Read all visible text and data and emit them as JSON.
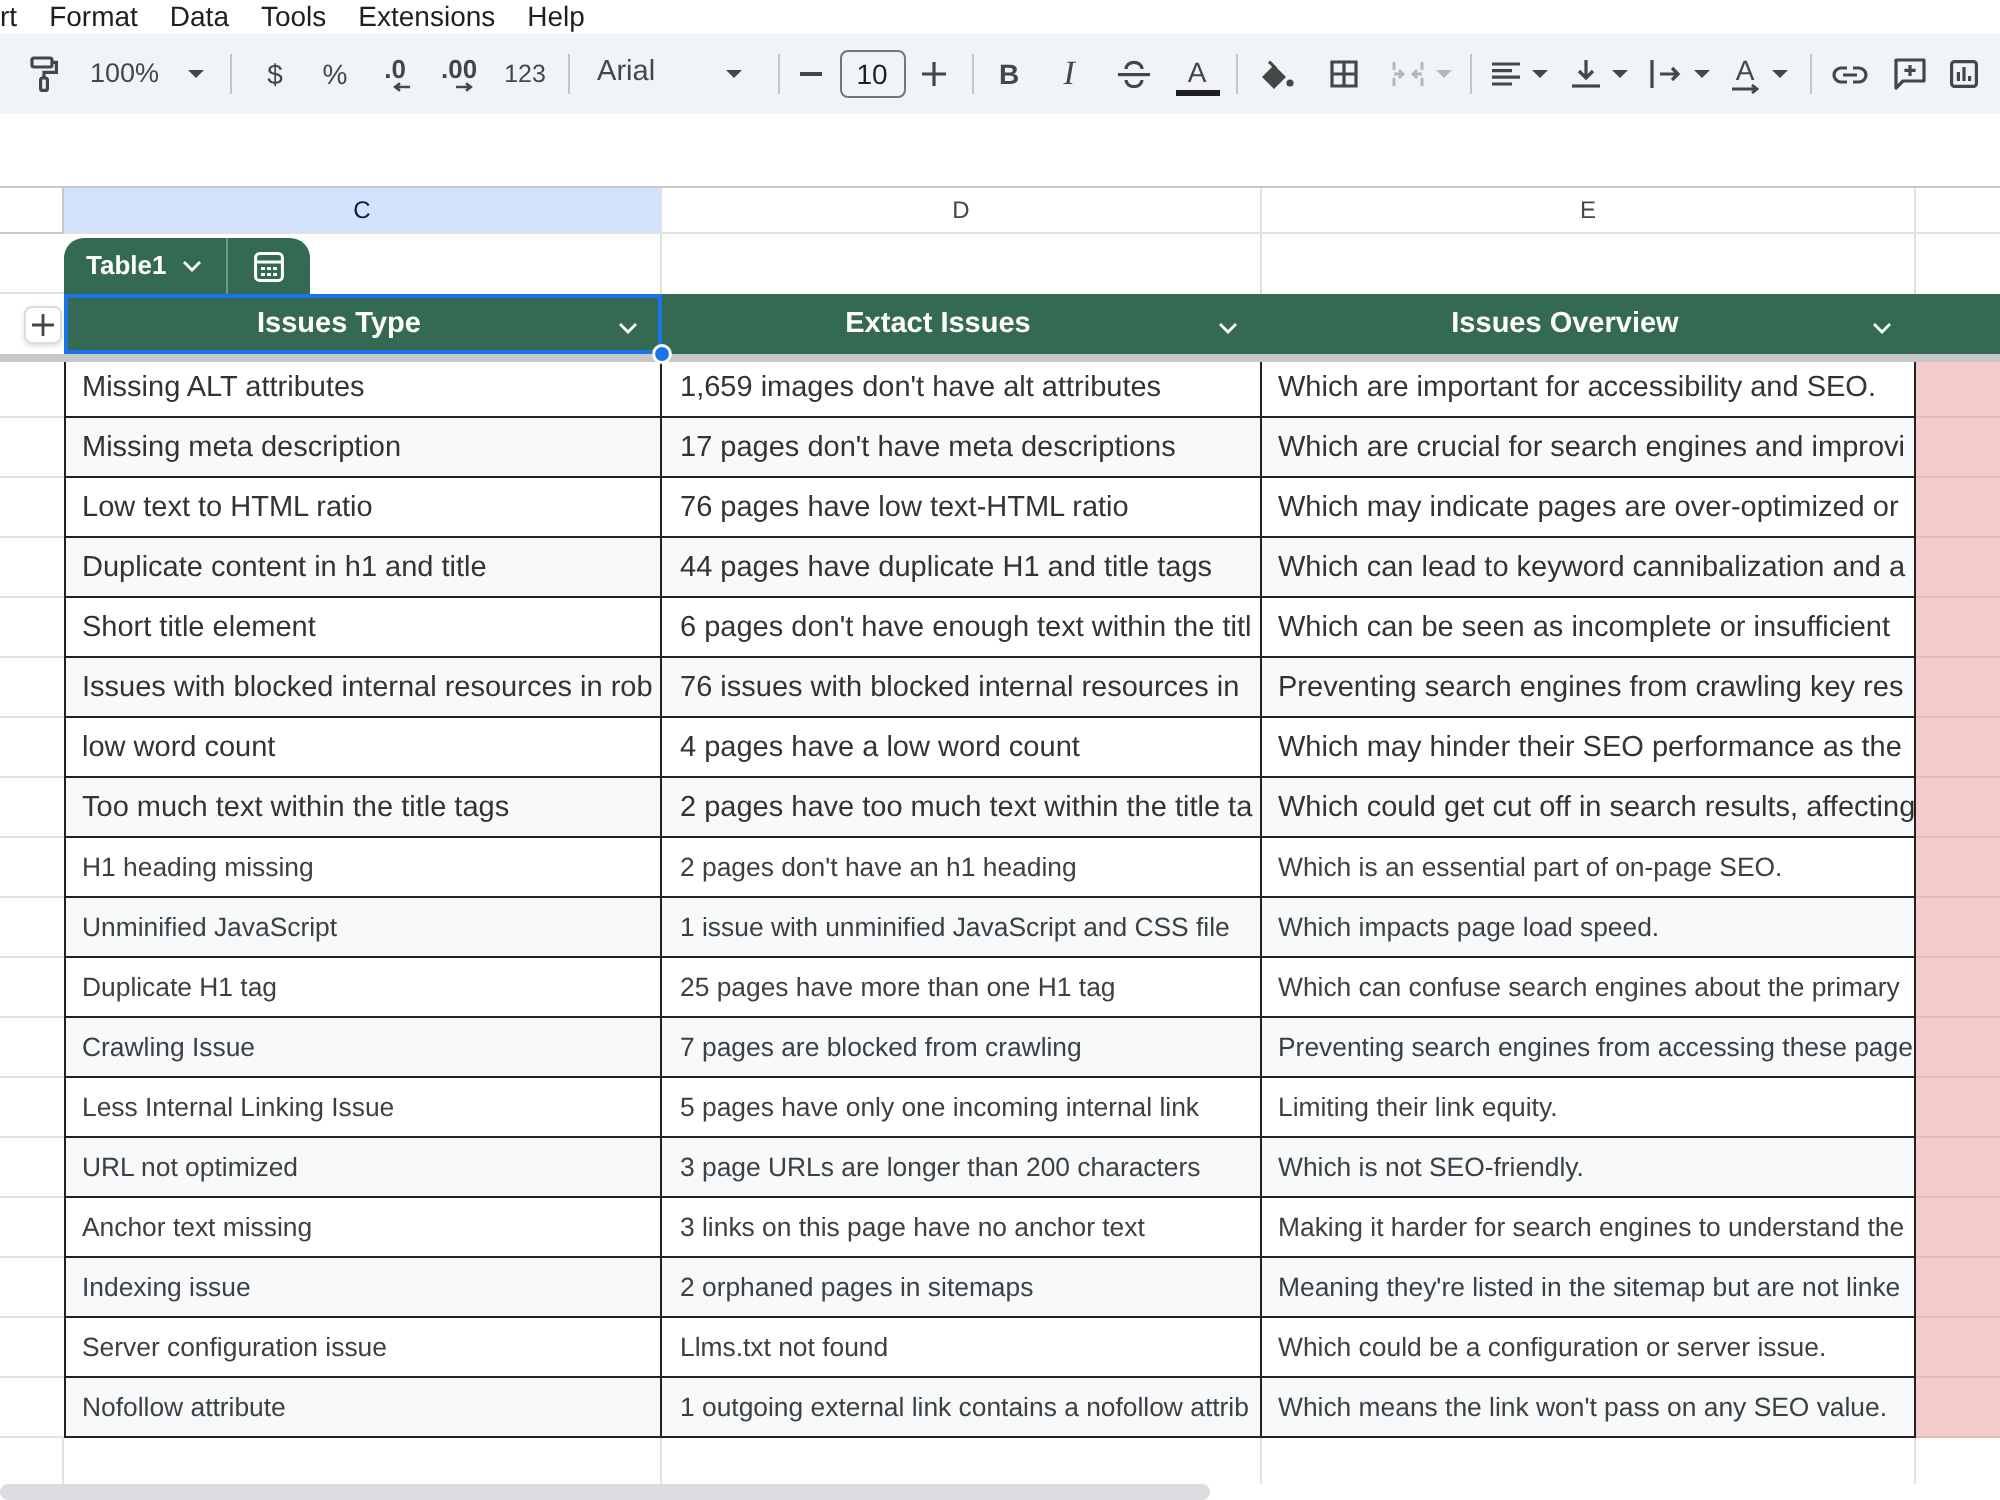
{
  "menu_bar": {
    "items": [
      "rt",
      "Format",
      "Data",
      "Tools",
      "Extensions",
      "Help"
    ]
  },
  "toolbar": {
    "zoom": "100%",
    "currency": "$",
    "percent": "%",
    "decimal_buttons": [
      {
        "label": ".0",
        "kind": "decrease"
      },
      {
        "label": ".00",
        "kind": "increase"
      }
    ],
    "number_format": "123",
    "font": "Arial",
    "font_size": "10",
    "bold": "B",
    "italic": "I",
    "text_color": "A",
    "merge_cells": {
      "disabled": true
    },
    "text_rotation": "A"
  },
  "sheet": {
    "columns": [
      {
        "letter": "C",
        "selected": true
      },
      {
        "letter": "D",
        "selected": false
      },
      {
        "letter": "E",
        "selected": false
      }
    ],
    "table": {
      "name": "Table1",
      "headers": [
        {
          "label": "Issues Type",
          "selected": true
        },
        {
          "label": "Extact Issues",
          "selected": false
        },
        {
          "label": "Issues Overview",
          "selected": false
        }
      ],
      "rows": [
        [
          "Missing ALT attributes",
          "1,659 images don't have alt attributes",
          "Which are important for accessibility and SEO."
        ],
        [
          "Missing meta description",
          "17 pages don't have meta descriptions",
          "Which are crucial for search engines and improvi"
        ],
        [
          "Low text to HTML ratio",
          "76 pages have low text-HTML ratio",
          "Which may indicate pages are over-optimized or"
        ],
        [
          "Duplicate content in h1 and title",
          "44 pages have duplicate H1 and title tags",
          "Which can lead to keyword cannibalization and a"
        ],
        [
          "Short title element",
          "6 pages don't have enough text within the titl",
          "Which can be seen as incomplete or insufficient"
        ],
        [
          "Issues with blocked internal resources in rob",
          "76 issues with blocked internal resources in",
          "Preventing search engines from crawling key res"
        ],
        [
          "low word count",
          "4 pages have a low word count",
          "Which may hinder their SEO performance as the"
        ],
        [
          "Too much text within the title tags",
          "2 pages have too much text within the title ta",
          "Which could get cut off in search results, affecting"
        ],
        [
          "H1 heading missing",
          "2 pages don't have an h1 heading",
          "Which is an essential part of on-page SEO."
        ],
        [
          "Unminified JavaScript",
          "1 issue with unminified JavaScript and CSS file",
          "Which impacts page load speed."
        ],
        [
          "Duplicate H1 tag",
          "25 pages have more than one H1 tag",
          "Which can confuse search engines about the primary"
        ],
        [
          "Crawling Issue",
          "7 pages are blocked from crawling",
          "Preventing search engines from accessing these page"
        ],
        [
          "Less Internal Linking Issue",
          "5 pages have only one incoming internal link",
          "Limiting their link equity."
        ],
        [
          "URL not optimized",
          "3 page URLs are longer than 200 characters",
          "Which is not SEO-friendly."
        ],
        [
          "Anchor text missing",
          "3 links on this page have no anchor text",
          "Making it harder for search engines to understand the"
        ],
        [
          "Indexing issue",
          "2 orphaned pages in sitemaps",
          "Meaning they're listed in the sitemap but are not linke"
        ],
        [
          "Server configuration issue",
          "Llms.txt not found",
          "Which could be a configuration or server issue."
        ],
        [
          "Nofollow attribute",
          "1 outgoing external link contains a nofollow attrib",
          "Which means the link won't pass on any SEO value."
        ]
      ]
    }
  }
}
